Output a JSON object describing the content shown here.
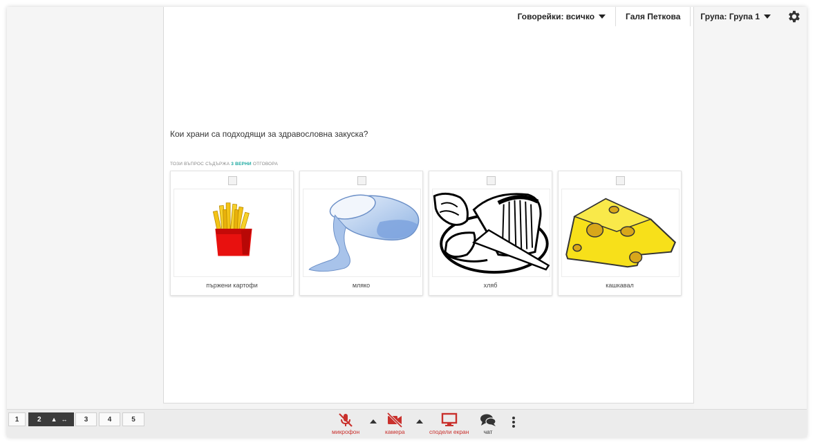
{
  "topbar": {
    "speakers": "Говорейки: всичко",
    "user": "Галя Петкова",
    "group": "Група: Група 1"
  },
  "question": {
    "text": "Кои храни са подходящи за здравословна закуска?",
    "note_prefix": "ТОЗИ ВЪПРОС СЪДЪРЖА ",
    "note_highlight": "3 ВЕРНИ",
    "note_suffix": " ОТГОВОРА",
    "answers": [
      {
        "label": "пържени картофи",
        "icon": "fries-image"
      },
      {
        "label": "мляко",
        "icon": "milk-image"
      },
      {
        "label": "хляб",
        "icon": "bread-image"
      },
      {
        "label": "кашкавал",
        "icon": "cheese-image"
      }
    ]
  },
  "slides": {
    "items": [
      "1",
      "2",
      "3",
      "4",
      "5"
    ],
    "active": "2"
  },
  "media": {
    "mic": "микрофон",
    "camera": "камера",
    "share": "сподели екран",
    "chat": "чат"
  },
  "colors": {
    "accent_red": "#c9302c",
    "highlight_teal": "#1aa8a0",
    "active_slide": "#3b3b3b"
  }
}
